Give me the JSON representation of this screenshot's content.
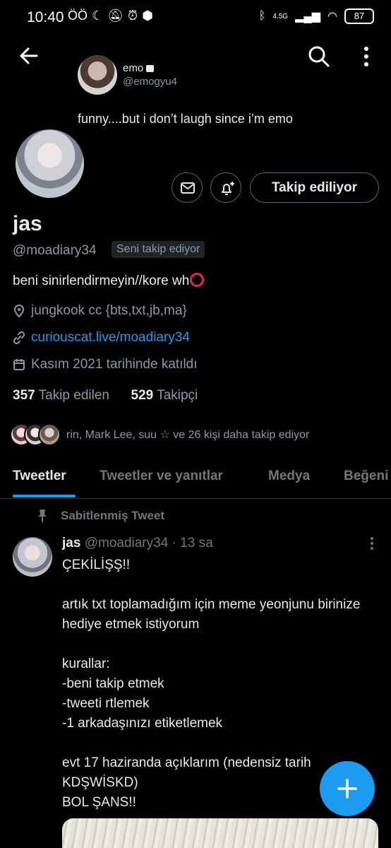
{
  "status_bar": {
    "time": "10:40",
    "extra": "ÖÖ",
    "network": "4.5G",
    "battery": "87"
  },
  "header": {
    "mini_name": "emo",
    "mini_handle": "@emogyu4",
    "mini_bio": "funny....but i don’t laugh since i’m emo"
  },
  "profile": {
    "follow_button": "Takip ediliyor",
    "name": "jas",
    "handle": "@moadiary34",
    "follows_you": "Seni takip ediyor",
    "bio": "beni sinirlendirmeyin//kore wh",
    "location": "jungkook cc {bts,txt,jb,ma}",
    "link": "curiouscat.live/moadiary34",
    "joined": "Kasım 2021 tarihinde katıldı",
    "following_count": "357",
    "following_label": "Takip edilen",
    "followers_count": "529",
    "followers_label": "Takipçi",
    "followed_by": "rin, Mark Lee, suu ☆ ve 26 kişi daha takip ediyor"
  },
  "tabs": [
    "Tweetler",
    "Tweetler ve yanıtlar",
    "Medya",
    "Beğeni"
  ],
  "tweet": {
    "pinned_label": "Sabitlenmiş Tweet",
    "author_name": "jas",
    "author_meta": "@moadiary34 · 13 sa",
    "lines": [
      "ÇEKİLİŞŞ!!",
      "",
      "artık txt toplamadığım için meme yeonjunu birinize hediye etmek istiyorum",
      "",
      "kurallar:",
      "-beni takip etmek",
      "-tweeti rtlemek",
      "-1 arkadaşınızı etiketlemek",
      "",
      "evt 17 haziranda açıklarım (nedensiz tarih KDŞWİSKD)",
      "BOL ŞANS!!"
    ]
  },
  "colors": {
    "accent": "#1d9bf0",
    "background": "#000000",
    "muted": "#71767b"
  },
  "icons": [
    "back-arrow-icon",
    "search-icon",
    "more-vertical-icon",
    "mail-icon",
    "bell-plus-icon",
    "location-pin-icon",
    "link-icon",
    "calendar-icon",
    "pin-icon",
    "compose-plus-icon"
  ]
}
